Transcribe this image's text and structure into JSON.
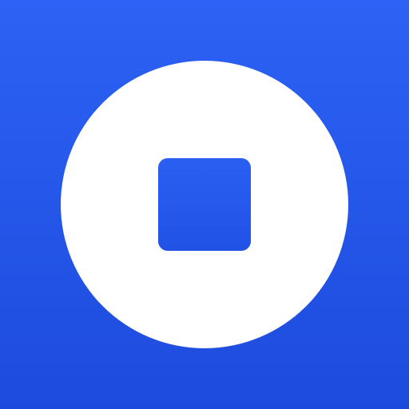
{
  "app_icon": {
    "icon": "stop-icon",
    "background_colors": [
      "#2C62F5",
      "#1D4BDD"
    ],
    "circle_color": "#FFFFFF",
    "square_color": "#2556EC"
  }
}
